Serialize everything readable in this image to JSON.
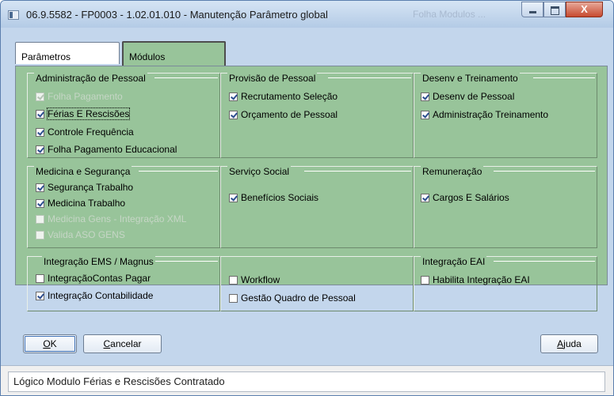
{
  "window": {
    "title": "06.9.5582 - FP0003 - 1.02.01.010 - Manutenção Parâmetro global",
    "ghost_title": "Folha Modulos ...",
    "close_glyph": "X"
  },
  "tabs": [
    {
      "label": "Parâmetros"
    },
    {
      "label": "Módulos"
    }
  ],
  "groups": {
    "admin": {
      "title": "Administração de Pessoal",
      "items": [
        {
          "label": "Folha Pagamento",
          "checked": true,
          "disabled": true
        },
        {
          "label": "Férias E Rescisões",
          "checked": true,
          "disabled": false
        },
        {
          "label": "Controle Frequência",
          "checked": true,
          "disabled": false
        },
        {
          "label": "Folha Pagamento Educacional",
          "checked": true,
          "disabled": false
        }
      ]
    },
    "provisao": {
      "title": "Provisão de Pessoal",
      "items": [
        {
          "label": "Recrutamento Seleção",
          "checked": true,
          "disabled": false
        },
        {
          "label": "Orçamento de Pessoal",
          "checked": true,
          "disabled": false
        }
      ]
    },
    "desenv": {
      "title": "Desenv e Treinamento",
      "items": [
        {
          "label": "Desenv de Pessoal",
          "checked": true,
          "disabled": false
        },
        {
          "label": "Administração Treinamento",
          "checked": true,
          "disabled": false
        }
      ]
    },
    "medicina": {
      "title": "Medicina e Segurança",
      "items": [
        {
          "label": "Segurança Trabalho",
          "checked": true,
          "disabled": false
        },
        {
          "label": "Medicina Trabalho",
          "checked": true,
          "disabled": false
        },
        {
          "label": "Medicina Gens - Integração XML",
          "checked": false,
          "disabled": true
        },
        {
          "label": "Valida ASO GENS",
          "checked": false,
          "disabled": true
        }
      ]
    },
    "servico": {
      "title": "Serviço Social",
      "items": [
        {
          "label": "Benefícios Sociais",
          "checked": true,
          "disabled": false
        }
      ]
    },
    "remuneracao": {
      "title": "Remuneração",
      "items": [
        {
          "label": "Cargos E Salários",
          "checked": true,
          "disabled": false
        }
      ]
    },
    "ems": {
      "title": "Integração EMS / Magnus",
      "items": [
        {
          "label": "IntegraçãoContas Pagar",
          "checked": false,
          "disabled": false
        },
        {
          "label": "Integração Contabilidade",
          "checked": true,
          "disabled": false
        }
      ]
    },
    "workflow": {
      "title": "",
      "items": [
        {
          "label": "Workflow",
          "checked": false,
          "disabled": false
        },
        {
          "label": "Gestão Quadro de Pessoal",
          "checked": false,
          "disabled": false
        }
      ]
    },
    "eai": {
      "title": "Integração EAI",
      "items": [
        {
          "label": "Habilita Integração EAI",
          "checked": false,
          "disabled": false
        }
      ]
    }
  },
  "buttons": {
    "ok": {
      "accel": "O",
      "rest": "K"
    },
    "cancel": {
      "accel": "C",
      "rest": "ancelar"
    },
    "help": {
      "accel": "A",
      "rest": "juda"
    }
  },
  "status": {
    "text": "Lógico Modulo Férias e Rescisões Contratado"
  }
}
